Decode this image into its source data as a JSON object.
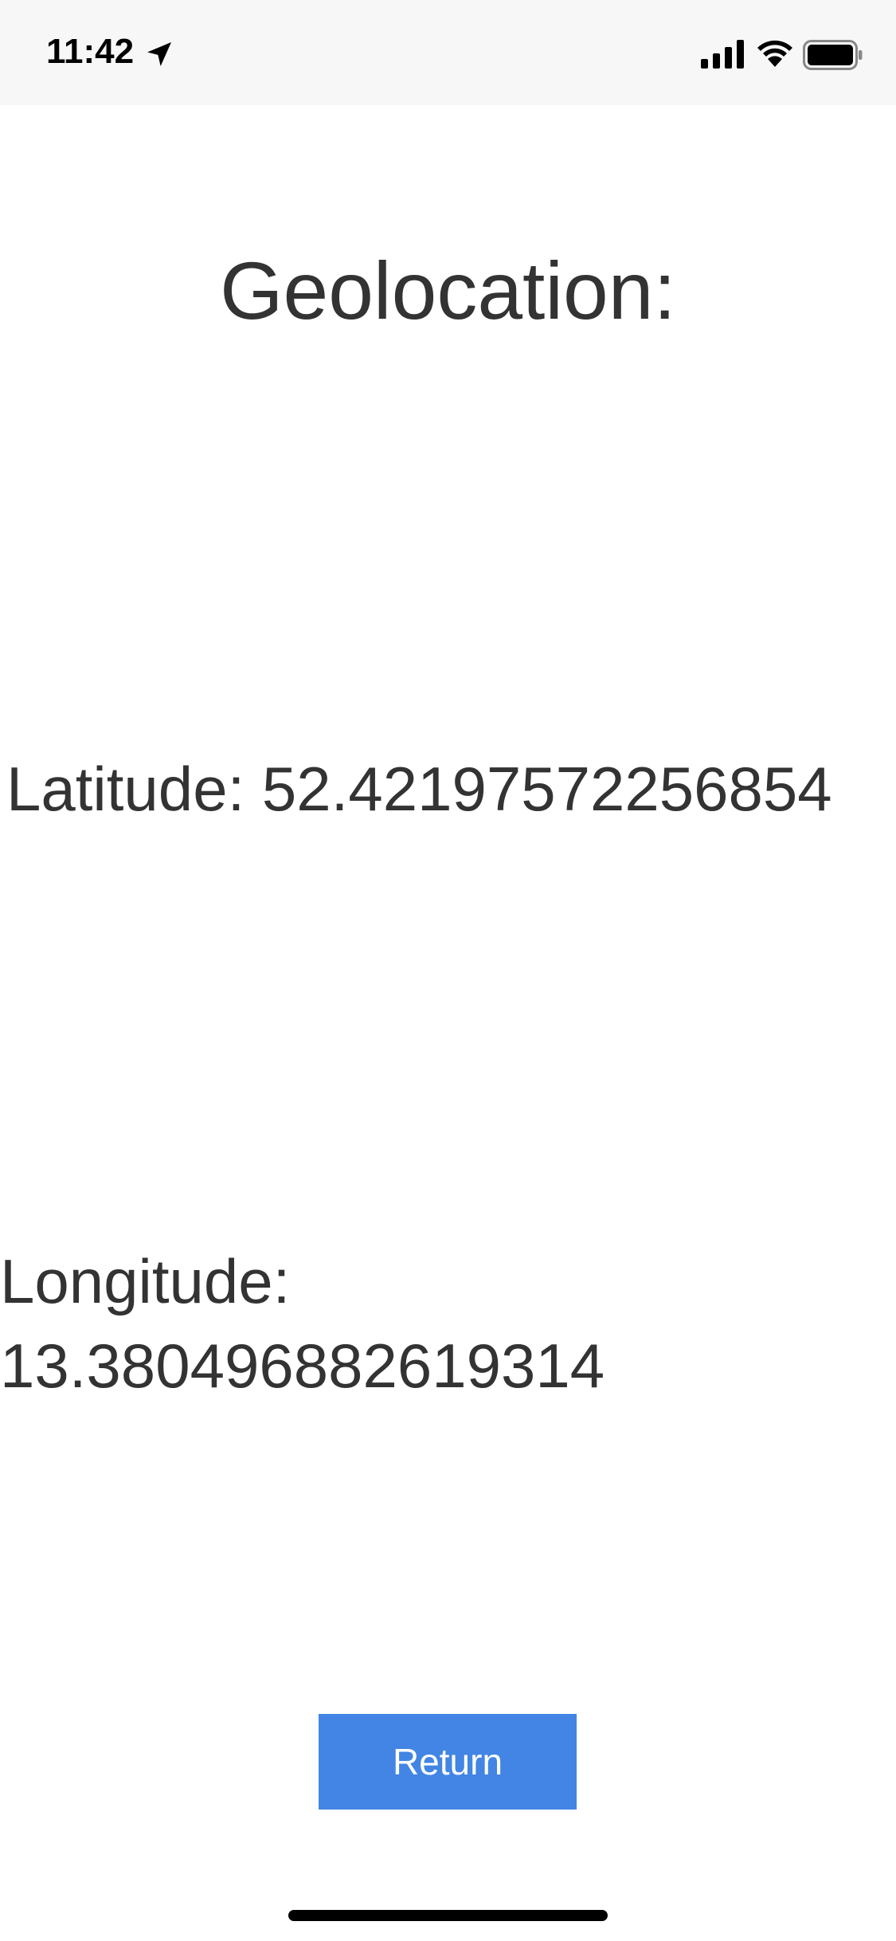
{
  "status_bar": {
    "time": "11:42",
    "icons": {
      "location": "location-arrow-icon",
      "signal": "cellular-signal-icon",
      "wifi": "wifi-icon",
      "battery": "battery-icon"
    }
  },
  "main": {
    "title": "Geolocation:",
    "latitude_text": "Latitude: 52.42197572256854",
    "longitude_label": "Longitude:",
    "longitude_value": "13.380496882619314"
  },
  "actions": {
    "return_label": "Return"
  },
  "colors": {
    "button_background": "#4285e4",
    "button_text": "#ffffff",
    "text": "#333333",
    "status_bar_background": "#f7f7f7"
  }
}
